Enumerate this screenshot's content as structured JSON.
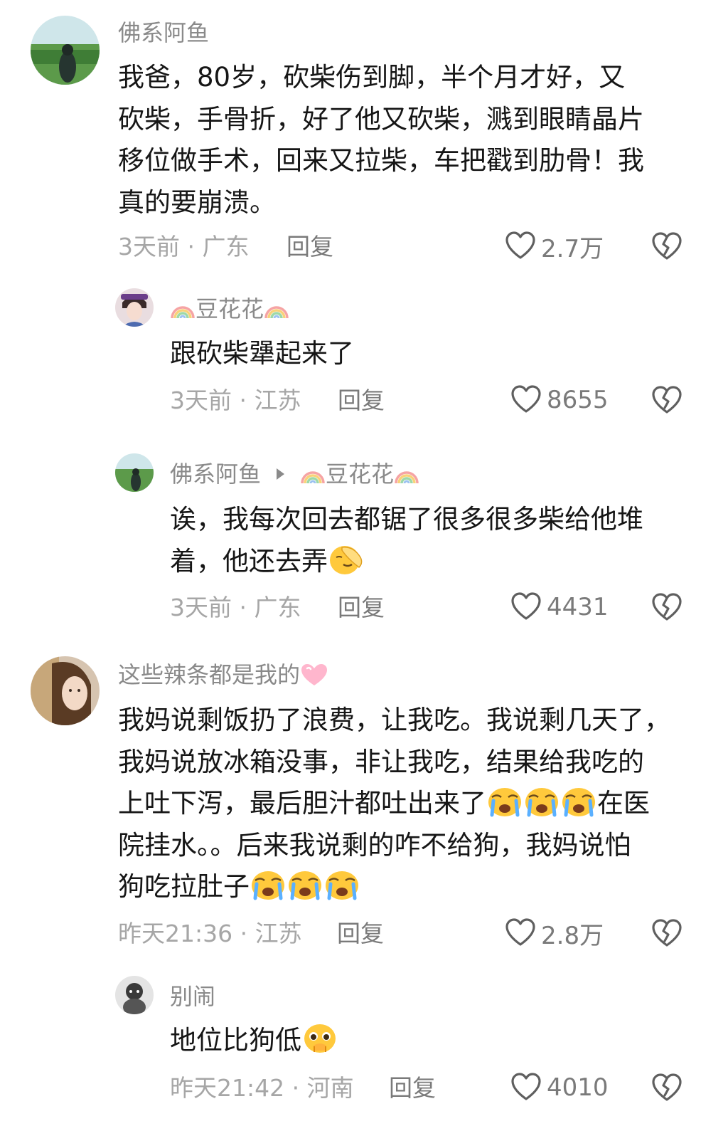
{
  "comments": [
    {
      "username": "佛系阿鱼",
      "lines": [
        "我爸，80岁，砍柴伤到脚，半个月才好，又",
        "砍柴，手骨折，好了他又砍柴，溅到眼睛晶片",
        "移位做手术，回来又拉柴，车把戳到肋骨！我",
        "真的要崩溃。"
      ],
      "meta": "3天前 · 广东",
      "reply_label": "回复",
      "likes": "2.7万",
      "replies": [
        {
          "username": "豆花花",
          "lines": [
            "跟砍柴犟起来了"
          ],
          "meta": "3天前 · 江苏",
          "reply_label": "回复",
          "likes": "8655"
        },
        {
          "username": "佛系阿鱼",
          "reply_to": "豆花花",
          "lines": [
            "诶，我每次回去都锯了很多很多柴给他堆",
            "着，他还去弄"
          ],
          "meta": "3天前 · 广东",
          "reply_label": "回复",
          "likes": "4431"
        }
      ]
    },
    {
      "username": "这些辣条都是我的",
      "lines": [
        "我妈说剩饭扔了浪费，让我吃。我说剩几天了，",
        "我妈说放冰箱没事，非让我吃，结果给我吃的",
        "上吐下泻，最后胆汁都吐出来了",
        "在医",
        "院挂水。。后来我说剩的咋不给狗，我妈说怕",
        "狗吃拉肚子"
      ],
      "meta": "昨天21:36 · 江苏",
      "reply_label": "回复",
      "likes": "2.8万",
      "replies": [
        {
          "username": "别闹",
          "lines": [
            "地位比狗低"
          ],
          "meta": "昨天21:42 · 河南",
          "reply_label": "回复",
          "likes": "4010"
        }
      ]
    }
  ],
  "icons": {
    "like": "heart-outline-icon",
    "dislike": "broken-heart-icon",
    "reply_arrow": "triangle-right-icon"
  },
  "colors": {
    "text": "#161616",
    "username": "#8a8a8a",
    "meta": "#a6a6a6",
    "action": "#7a7a7a"
  }
}
